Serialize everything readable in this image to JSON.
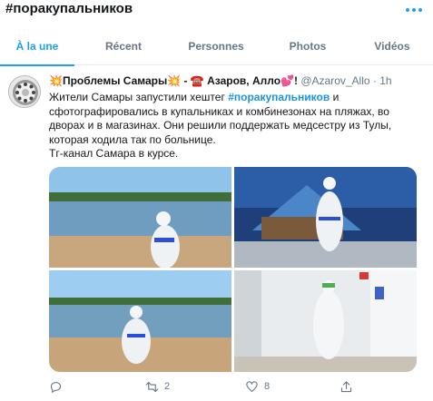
{
  "page": {
    "title": "#поракупальников"
  },
  "tabs": [
    {
      "label": "À la une",
      "active": true
    },
    {
      "label": "Récent",
      "active": false
    },
    {
      "label": "Personnes",
      "active": false
    },
    {
      "label": "Photos",
      "active": false
    },
    {
      "label": "Vidéos",
      "active": false
    }
  ],
  "tweet": {
    "author_name": "💥Проблемы Самары💥 - ☎️ Азаров, Алло💕!",
    "handle": "@Azarov_Allo",
    "time": "1h",
    "text_before": "Жители Самары запустили хештег ",
    "hashtag": "#поракупальников",
    "text_after": " и сфотографировались в купальниках и комбинезонах на пляжах, во дворах и в магазинах. Они решили поддержать медсестру из Тулы, которая ходила так по больнице.",
    "text_line2": "Тг-канал Самара в курсе.",
    "media": [
      {
        "icon": "photo-beach-person"
      },
      {
        "icon": "photo-mural-person"
      },
      {
        "icon": "photo-riverside-person"
      },
      {
        "icon": "photo-corridor-person"
      }
    ],
    "actions": {
      "reply": {
        "icon": "reply-icon",
        "count": ""
      },
      "retweet": {
        "icon": "retweet-icon",
        "count": "2"
      },
      "like": {
        "icon": "heart-icon",
        "count": "8"
      },
      "share": {
        "icon": "share-icon",
        "count": ""
      }
    }
  },
  "colors": {
    "accent": "#1da1f2",
    "text": "#14171a",
    "muted": "#657786",
    "border": "#e6ecf0"
  }
}
